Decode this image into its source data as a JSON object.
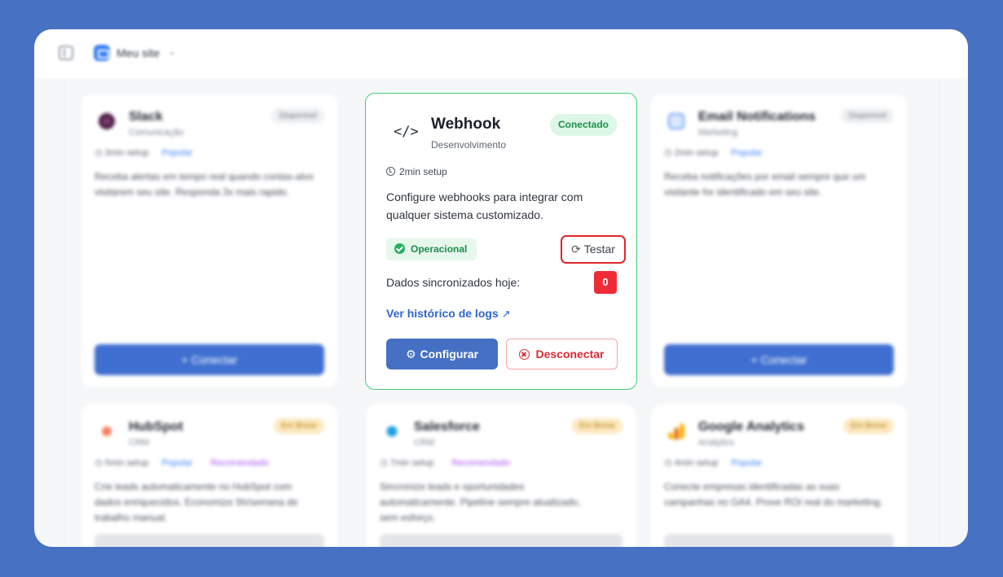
{
  "header": {
    "site_name": "Meu site",
    "chevron": "⌄"
  },
  "webhook": {
    "icon": "</>",
    "title": "Webhook",
    "category": "Desenvolvimento",
    "badge": "Conectado",
    "setup": "2min setup",
    "description": "Configure webhooks para integrar com qualquer sistema customizado.",
    "status": "Operacional",
    "test_label": "Testar",
    "sync_label": "Dados sincronizados hoje:",
    "sync_count": "0",
    "logs_link": "Ver histórico de logs",
    "configure_label": "Configurar",
    "disconnect_label": "Desconectar"
  },
  "cards": {
    "slack": {
      "title": "Slack",
      "category": "Comunicação",
      "badge": "Disponível",
      "setup": "3min setup",
      "tag": "Popular",
      "description": "Receba alertas em tempo real quando contas-alvo visitarem seu site. Responda 3x mais rapido.",
      "button": "+ Conectar"
    },
    "email": {
      "title": "Email Notifications",
      "category": "Marketing",
      "badge": "Disponível",
      "setup": "2min setup",
      "tag": "Popular",
      "description": "Receba notificações por email sempre que um visitante for identificado em seu site.",
      "button": "+ Conectar"
    },
    "hubspot": {
      "title": "HubSpot",
      "category": "CRM",
      "badge": "Em Breve",
      "setup": "5min setup",
      "tag": "Popular",
      "tag2": "Recomendado",
      "description": "Crie leads automaticamente no HubSpot com dados enriquecidos. Economize 5h/semana de trabalho manual."
    },
    "salesforce": {
      "title": "Salesforce",
      "category": "CRM",
      "badge": "Em Breve",
      "setup": "7min setup",
      "tag2": "Recomendado",
      "description": "Sincronize leads e oportunidades automaticamente. Pipeline sempre atualizado, sem esforço."
    },
    "ga": {
      "title": "Google Analytics",
      "category": "Analytics",
      "badge": "Em Breve",
      "setup": "4min setup",
      "tag": "Popular",
      "description": "Conecte empresas identificadas as suas campanhas no GA4. Prove ROI real do marketing."
    }
  },
  "colors": {
    "background": "#4771c2",
    "accent": "#3f6fd0",
    "connected": "#1e8f4d",
    "danger": "#d92a33"
  }
}
